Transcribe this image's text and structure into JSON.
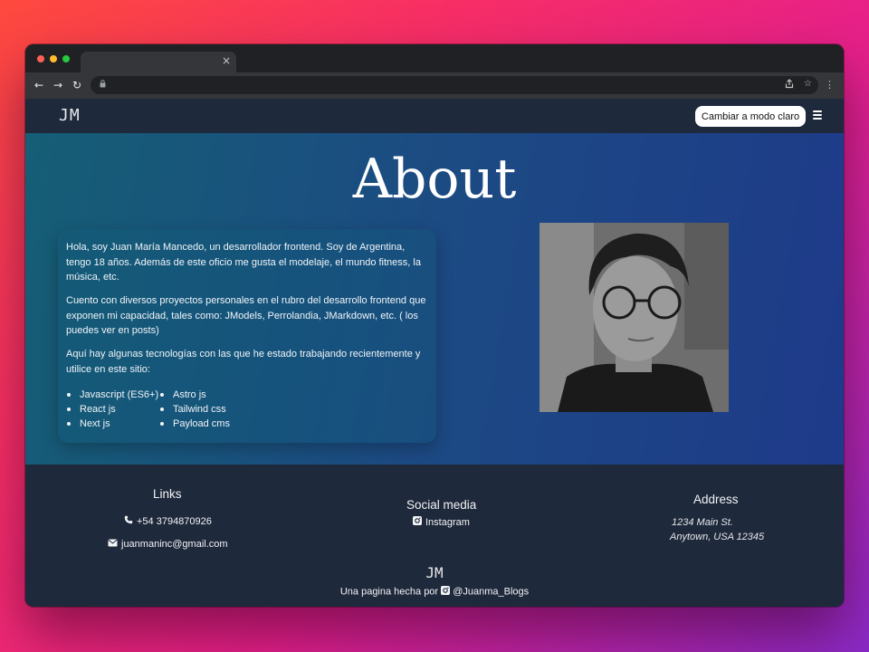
{
  "browser": {
    "tab_close": "×",
    "nav": {
      "back": "←",
      "forward": "→",
      "reload": "↻"
    },
    "lock": "🔒",
    "share": "⇪",
    "star": "☆",
    "menu": "⋮"
  },
  "site": {
    "logo": "JM",
    "theme_toggle_label": "Cambiar a modo claro",
    "icons": {
      "menu": "hamburger-icon"
    }
  },
  "about": {
    "title": "About",
    "paragraphs": [
      "Hola, soy Juan María Mancedo, un desarrollador frontend. Soy de Argentina, tengo 18 años. Además de este oficio me gusta el modelaje, el mundo fitness, la música, etc.",
      "Cuento con diversos proyectos personales en el rubro del desarrollo frontend que exponen mi capacidad, tales como: JModels, Perrolandia, JMarkdown, etc. ( los puedes ver en posts)",
      "Aquí hay algunas tecnologías con las que he estado trabajando recientemente y utilice en este sitio:"
    ],
    "tech_col1": [
      "Javascript (ES6+)",
      "React js",
      "Next js"
    ],
    "tech_col2": [
      "Astro js",
      "Tailwind css",
      "Payload cms"
    ]
  },
  "footer": {
    "links_heading": "Links",
    "phone": "+54 3794870926",
    "email": "juanmaninc@gmail.com",
    "social_heading": "Social media",
    "instagram": "Instagram",
    "address_heading": "Address",
    "address_line1": "1234 Main St.",
    "address_line2": "Anytown, USA 12345",
    "logo": "JM",
    "credit_prefix": "Una pagina hecha por",
    "credit_handle": "@Juanma_Blogs"
  },
  "colors": {
    "nav_bg": "#1e293b",
    "hero_gradient_start": "#155e75",
    "hero_gradient_end": "#1e3a8a",
    "footer_bg": "#1e293b"
  }
}
